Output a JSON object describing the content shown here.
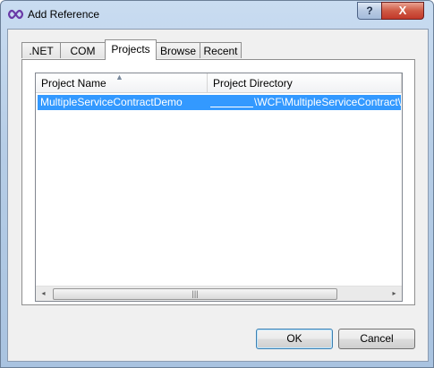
{
  "window": {
    "title": "Add Reference",
    "title_icon": "visual-studio-infinity-icon",
    "help_glyph": "?",
    "close_glyph": "X"
  },
  "tabs": [
    {
      "label": ".NET",
      "selected": false
    },
    {
      "label": "COM",
      "selected": false
    },
    {
      "label": "Projects",
      "selected": true
    },
    {
      "label": "Browse",
      "selected": false
    },
    {
      "label": "Recent",
      "selected": false
    }
  ],
  "list": {
    "columns": [
      "Project Name",
      "Project Directory"
    ],
    "sort_indicator": "ascending",
    "rows": [
      {
        "name": "MultipleServiceContractDemo",
        "directory": "\\WCF\\MultipleServiceContract\\",
        "selected": true
      }
    ],
    "scroll": {
      "left_arrow": "◂",
      "right_arrow": "▸",
      "grip": "|||"
    }
  },
  "buttons": {
    "ok": "OK",
    "cancel": "Cancel"
  },
  "colors": {
    "selection": "#3399ff",
    "titlebar": "#b6cde6",
    "close_button": "#c2382a",
    "dialog_bg": "#f0f0f0"
  }
}
